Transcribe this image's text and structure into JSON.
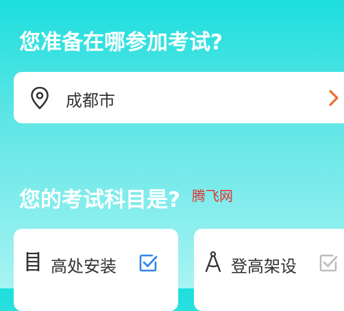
{
  "location_question": "您准备在哪参加考试?",
  "location": {
    "city": "成都市",
    "icon": "map-pin-icon",
    "arrow_icon": "chevron-right-icon",
    "arrow_color": "#ee6b2e"
  },
  "subject_question": "您的考试科目是?",
  "watermark": "腾飞网",
  "subjects": [
    {
      "label": "高处安装",
      "icon": "ladder-icon",
      "checked": true,
      "check_color": "#2e86e8"
    },
    {
      "label": "登高架设",
      "icon": "compass-icon",
      "checked": false,
      "check_color": "#bdbdbd"
    }
  ]
}
